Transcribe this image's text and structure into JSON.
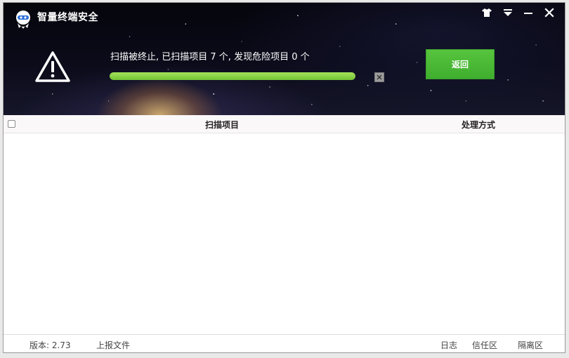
{
  "app": {
    "title": "智量终端安全"
  },
  "titlebar": {
    "icons": [
      "skin-icon",
      "menu-icon",
      "minimize-icon",
      "close-icon"
    ]
  },
  "scan": {
    "status_text": "扫描被终止, 已扫描项目 7 个, 发现危险项目 0 个",
    "progress": 1.0,
    "back_label": "返回"
  },
  "table": {
    "columns": [
      "扫描项目",
      "处理方式"
    ],
    "rows": []
  },
  "footer": {
    "version": "版本: 2.73",
    "upload": "上报文件",
    "log": "日志",
    "trust": "信任区",
    "quarantine": "隔离区"
  },
  "colors": {
    "accent_green": "#4fba38",
    "progress_green": "#8fd448",
    "header_dark": "#0b0b1a"
  }
}
